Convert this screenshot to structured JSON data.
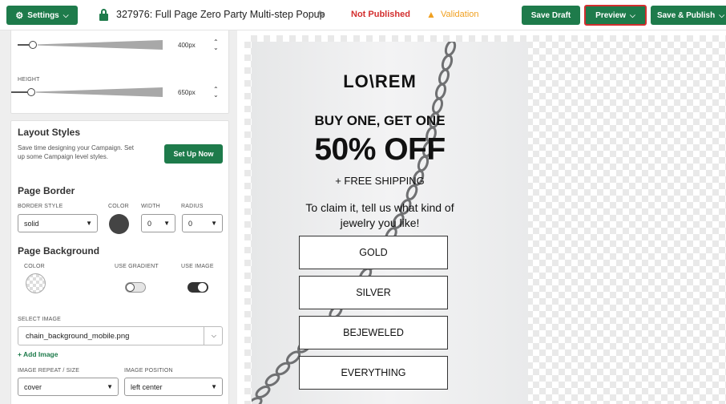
{
  "topbar": {
    "settings_label": "Settings",
    "title": "327976: Full Page Zero Party Multi-step Popup",
    "status": "Not Published",
    "validation": "Validation",
    "save_draft": "Save Draft",
    "preview": "Preview",
    "save_publish": "Save & Publish"
  },
  "sidebar": {
    "width": {
      "value": "400px"
    },
    "height": {
      "label": "HEIGHT",
      "value": "650px"
    },
    "layout_styles": {
      "title": "Layout Styles",
      "description_line1": "Save time designing your Campaign. Set",
      "description_line2": "up some Campaign level styles.",
      "button": "Set Up Now"
    },
    "page_border": {
      "title": "Page Border",
      "style_label": "BORDER STYLE",
      "style_value": "solid",
      "color_label": "COLOR",
      "color": "#444444",
      "width_label": "WIDTH",
      "width_value": "0",
      "radius_label": "RADIUS",
      "radius_value": "0"
    },
    "page_background": {
      "title": "Page Background",
      "color_label": "COLOR",
      "gradient_label": "USE GRADIENT",
      "use_gradient": false,
      "image_label": "USE IMAGE",
      "use_image": true,
      "select_image_label": "SELECT IMAGE",
      "image_value": "chain_background_mobile.png",
      "add_image": "+ Add Image",
      "repeat_label": "IMAGE REPEAT / SIZE",
      "repeat_value": "cover",
      "position_label": "IMAGE POSITION",
      "position_value": "left center"
    }
  },
  "preview": {
    "logo": "LO\\REM",
    "headline1": "BUY ONE, GET ONE",
    "headline2": "50% OFF",
    "shipping": "+ FREE SHIPPING",
    "claim_line1": "To claim it, tell us what kind of",
    "claim_line2": "jewelry you like!",
    "choices": [
      "GOLD",
      "SILVER",
      "BEJEWELED",
      "EVERYTHING"
    ]
  },
  "colors": {
    "brand_green": "#1e7b4b",
    "error_red": "#d32f2f",
    "warning_orange": "#f0a020"
  }
}
